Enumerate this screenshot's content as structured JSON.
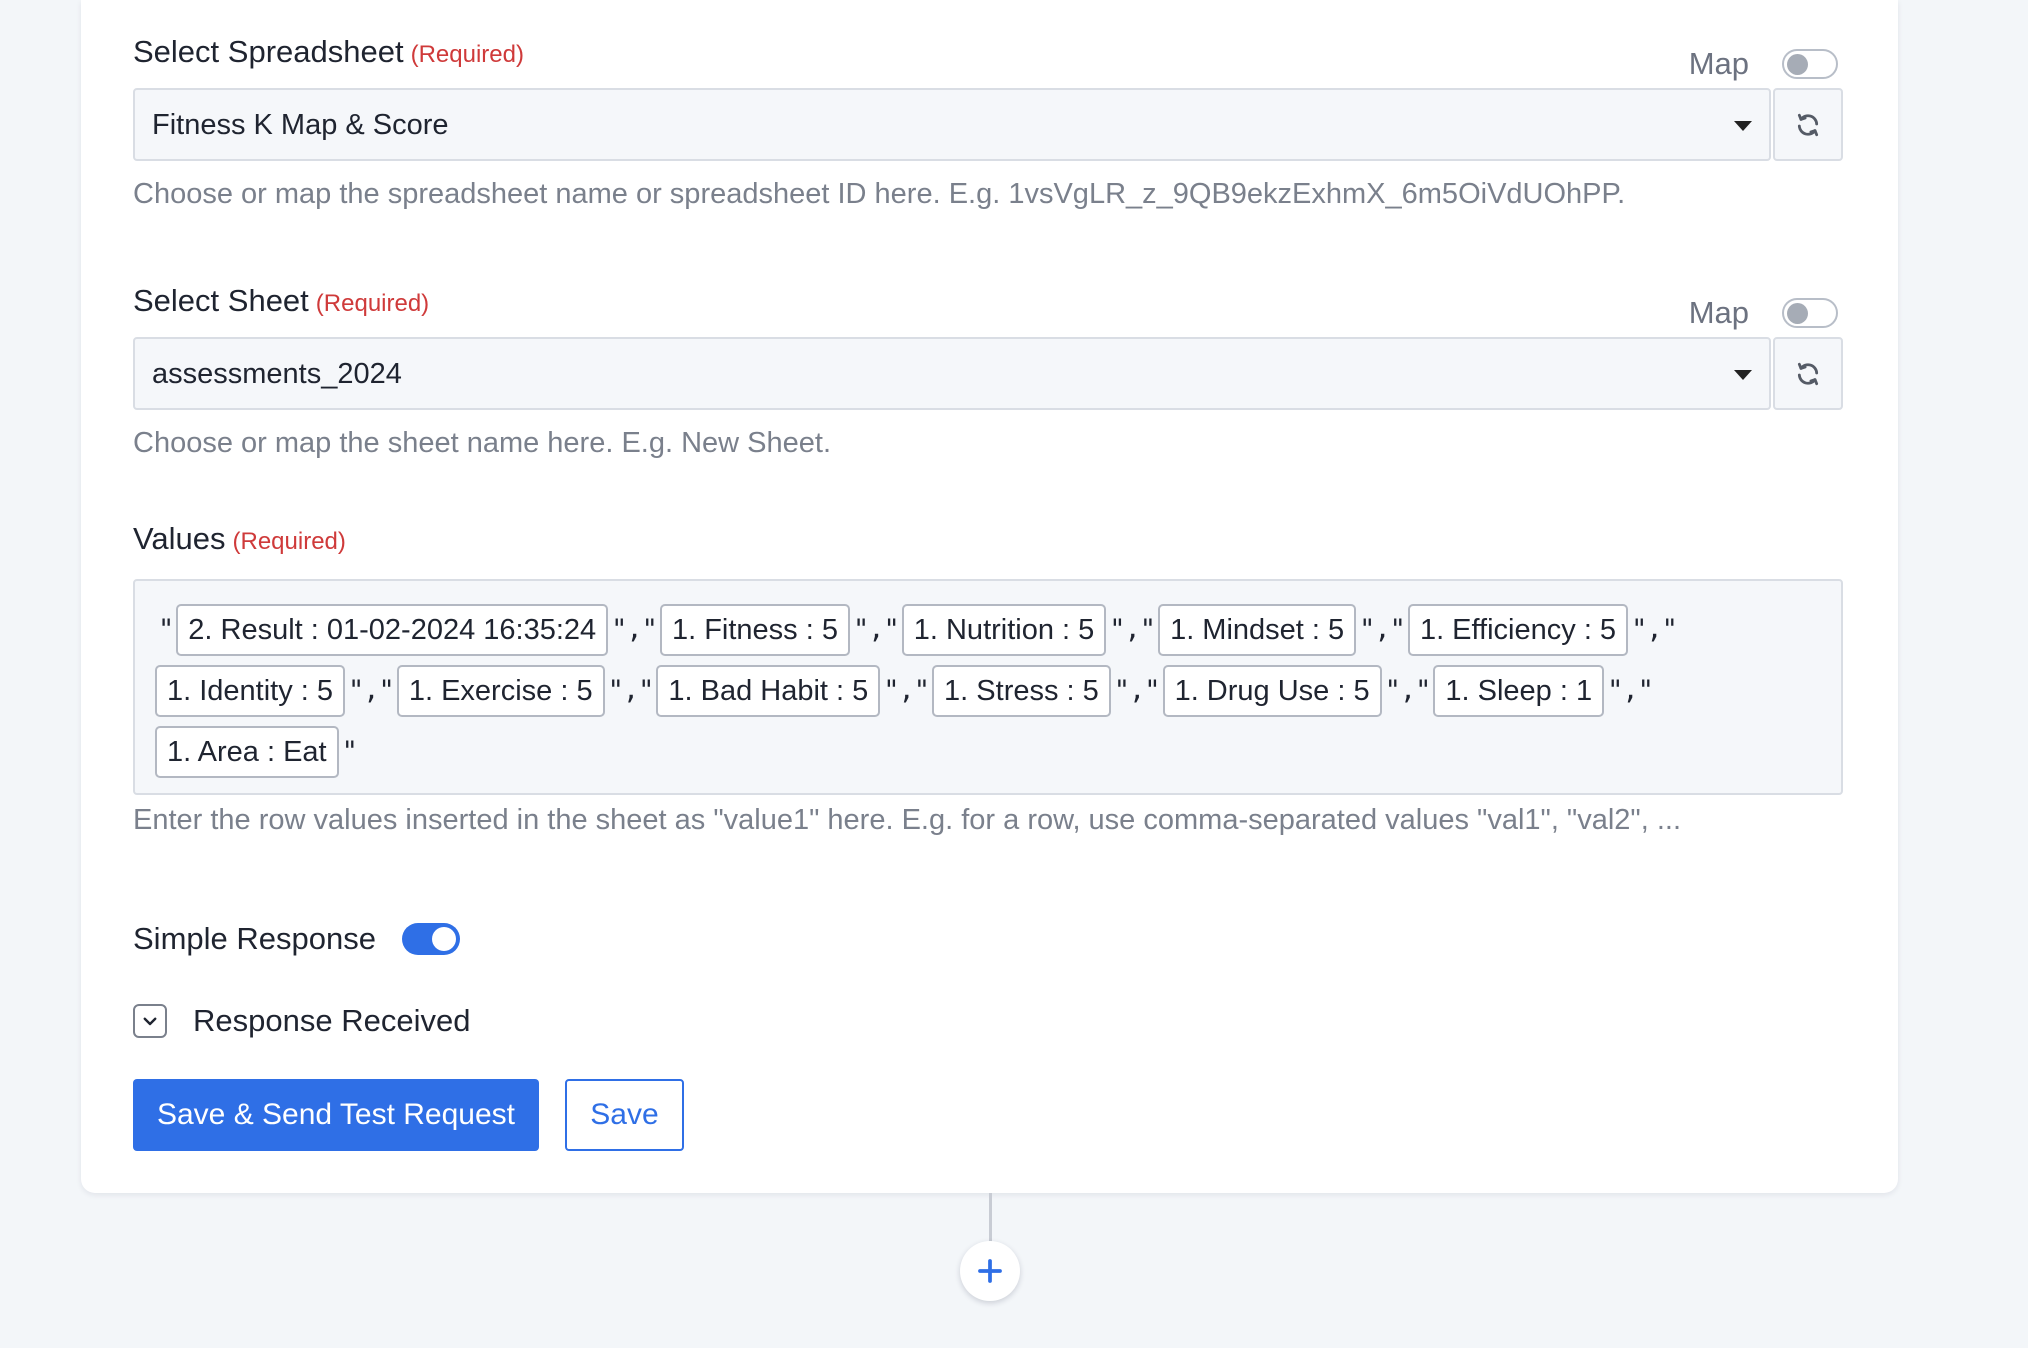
{
  "spreadsheet": {
    "label": "Select Spreadsheet",
    "required": "(Required)",
    "map_label": "Map",
    "value": "Fitness K Map & Score",
    "help": "Choose or map the spreadsheet name or spreadsheet ID here. E.g. 1vsVgLR_z_9QB9ekzExhmX_6m5OiVdUOhPP."
  },
  "sheet": {
    "label": "Select Sheet",
    "required": "(Required)",
    "map_label": "Map",
    "value": "assessments_2024",
    "help": "Choose or map the sheet name here. E.g. New Sheet."
  },
  "values": {
    "label": "Values",
    "required": "(Required)",
    "open_quote": "\"",
    "separator": "\",\"",
    "close_quote": "\"",
    "chips": [
      "2. Result : 01-02-2024 16:35:24",
      "1. Fitness : 5",
      "1. Nutrition : 5",
      "1. Mindset : 5",
      "1. Efficiency : 5",
      "1. Identity : 5",
      "1. Exercise : 5",
      "1. Bad Habit : 5",
      "1. Stress : 5",
      "1. Drug Use : 5",
      "1. Sleep : 1",
      "1. Area : Eat"
    ],
    "help": "Enter the row values inserted in the sheet as \"value1\" here. E.g. for a row, use comma-separated values \"val1\", \"val2\", ..."
  },
  "simple_response": {
    "label": "Simple Response",
    "enabled": true
  },
  "response_received": {
    "label": "Response Received"
  },
  "buttons": {
    "save_send": "Save & Send Test Request",
    "save": "Save"
  },
  "colors": {
    "accent": "#2f6fe6",
    "required": "#cf3a3a",
    "help_text": "#7a808c",
    "field_bg": "#f5f7fa"
  },
  "icons": {
    "refresh": "refresh-icon",
    "dropdown": "chevron-down-icon",
    "add": "plus-icon"
  }
}
